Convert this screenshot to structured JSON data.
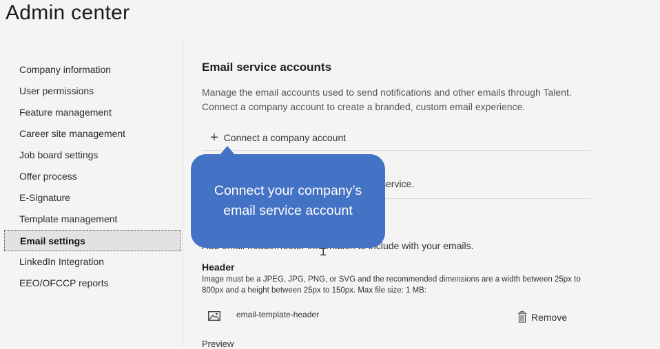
{
  "app": {
    "title": "Admin center"
  },
  "sidebar": {
    "items": [
      {
        "label": "Company information"
      },
      {
        "label": "User permissions"
      },
      {
        "label": "Feature management"
      },
      {
        "label": "Career site management"
      },
      {
        "label": "Job board settings"
      },
      {
        "label": "Offer process"
      },
      {
        "label": "E-Signature"
      },
      {
        "label": "Template management"
      },
      {
        "label": "Email settings",
        "active": true
      },
      {
        "label": "LinkedIn Integration"
      },
      {
        "label": "EEO/OFCCP reports"
      }
    ]
  },
  "main": {
    "section_title": "Email service accounts",
    "description_line1": "Manage the email accounts used to send notifications and other emails through Talent.",
    "description_line2": "Connect a company account to create a branded, custom email experience.",
    "connect_label": "Connect a company account",
    "connect_icon": "plus-icon",
    "obscured_text": "service.",
    "partial_text": "Add email header/footer information to include with your emails.",
    "header_label": "Header",
    "header_help_line1": "Image must be a JPEG, JPG, PNG, or SVG and the recommended dimensions are a width between 25px to",
    "header_help_line2": "800px and a height between 25px to 150px. Max file size: 1 MB:",
    "file_name": "email-template-header",
    "file_icon": "image-icon",
    "remove_label": "Remove",
    "remove_icon": "trash-icon",
    "preview_label": "Preview"
  },
  "callout": {
    "line1": "Connect your company’s",
    "line2": "email service account",
    "color": "#4472c4"
  }
}
